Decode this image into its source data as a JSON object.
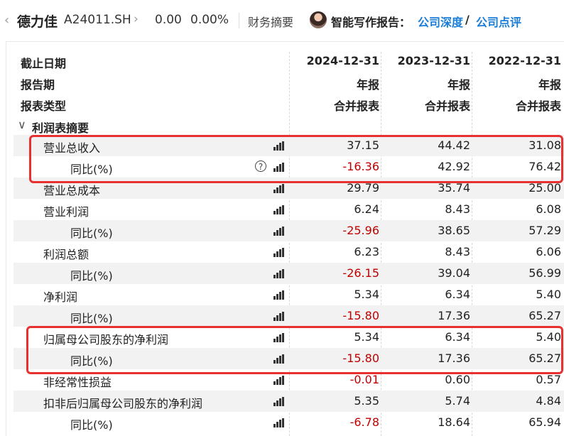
{
  "header": {
    "back_icon": "chevron-left-icon",
    "stock_name": "德力佳",
    "stock_code": "A24011.SH",
    "chevron": "›",
    "price": "0.00",
    "change_pct": "0.00%",
    "financial_summary": "财务摘要",
    "ai_report_label": "智能写作报告：",
    "link_deep": "公司深度",
    "slash": "/",
    "link_review": "公司点评"
  },
  "table": {
    "header_rows": [
      {
        "label": "截止日期",
        "values": [
          "2024-12-31",
          "2023-12-31",
          "2022-12-31"
        ]
      },
      {
        "label": "报告期",
        "values": [
          "年报",
          "年报",
          "年报"
        ]
      },
      {
        "label": "报表类型",
        "values": [
          "合并报表",
          "合并报表",
          "合并报表"
        ]
      }
    ],
    "section": {
      "caret": "∨",
      "label": "利润表摘要"
    },
    "rows": [
      {
        "label": "营业总收入",
        "indent": 1,
        "values": [
          "37.15",
          "44.42",
          "31.08"
        ],
        "neg": [
          false,
          false,
          false
        ],
        "help": false
      },
      {
        "label": "同比(%)",
        "indent": 2,
        "values": [
          "-16.36",
          "42.92",
          "76.42"
        ],
        "neg": [
          true,
          false,
          false
        ],
        "help": true
      },
      {
        "label": "营业总成本",
        "indent": 1,
        "values": [
          "29.79",
          "35.74",
          "25.00"
        ],
        "neg": [
          false,
          false,
          false
        ],
        "help": false
      },
      {
        "label": "营业利润",
        "indent": 1,
        "values": [
          "6.24",
          "8.43",
          "6.08"
        ],
        "neg": [
          false,
          false,
          false
        ],
        "help": false
      },
      {
        "label": "同比(%)",
        "indent": 2,
        "values": [
          "-25.96",
          "38.65",
          "57.29"
        ],
        "neg": [
          true,
          false,
          false
        ],
        "help": false
      },
      {
        "label": "利润总额",
        "indent": 1,
        "values": [
          "6.23",
          "8.43",
          "6.06"
        ],
        "neg": [
          false,
          false,
          false
        ],
        "help": false
      },
      {
        "label": "同比(%)",
        "indent": 2,
        "values": [
          "-26.15",
          "39.04",
          "56.99"
        ],
        "neg": [
          true,
          false,
          false
        ],
        "help": false
      },
      {
        "label": "净利润",
        "indent": 1,
        "values": [
          "5.34",
          "6.34",
          "5.40"
        ],
        "neg": [
          false,
          false,
          false
        ],
        "help": false
      },
      {
        "label": "同比(%)",
        "indent": 2,
        "values": [
          "-15.80",
          "17.36",
          "65.27"
        ],
        "neg": [
          true,
          false,
          false
        ],
        "help": false
      },
      {
        "label": "归属母公司股东的净利润",
        "indent": 1,
        "values": [
          "5.34",
          "6.34",
          "5.40"
        ],
        "neg": [
          false,
          false,
          false
        ],
        "help": false
      },
      {
        "label": "同比(%)",
        "indent": 2,
        "values": [
          "-15.80",
          "17.36",
          "65.27"
        ],
        "neg": [
          true,
          false,
          false
        ],
        "help": false
      },
      {
        "label": "非经常性损益",
        "indent": 1,
        "values": [
          "-0.01",
          "0.60",
          "0.57"
        ],
        "neg": [
          true,
          false,
          false
        ],
        "help": false
      },
      {
        "label": "扣非后归属母公司股东的净利润",
        "indent": 1,
        "values": [
          "5.35",
          "5.74",
          "4.84"
        ],
        "neg": [
          false,
          false,
          false
        ],
        "help": false
      },
      {
        "label": "同比(%)",
        "indent": 2,
        "values": [
          "-6.78",
          "18.64",
          "65.94"
        ],
        "neg": [
          true,
          false,
          false
        ],
        "help": false
      }
    ]
  },
  "colors": {
    "negative": "#c00000",
    "link": "#1a7ed8",
    "highlight": "#e83030",
    "row_shade": "#f2f2f2"
  }
}
